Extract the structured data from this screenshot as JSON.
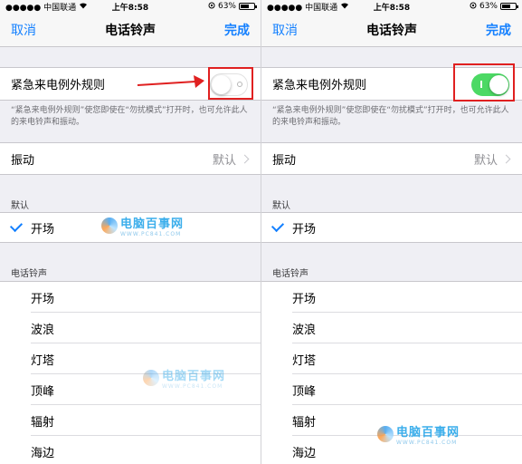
{
  "screens": [
    {
      "status": {
        "carrier": "●●●●● 中国联通",
        "wifi_icon": "wifi-icon",
        "time": "上午8:58",
        "battery": "63%",
        "battery_level": 0.63
      },
      "nav": {
        "cancel": "取消",
        "title": "电话铃声",
        "done": "完成"
      },
      "emergency": {
        "label": "紧急来电例外规则",
        "switch_on": false,
        "note": "“紧急来电例外规则”使您即使在“勿扰模式”打开时，也可允许此人的来电铃声和振动。"
      },
      "vibration": {
        "label": "振动",
        "value": "默认"
      },
      "default_header": "默认",
      "selected_tone": "开场",
      "ringtones_header": "电话铃声",
      "ringtones": [
        "开场",
        "波浪",
        "灯塔",
        "顶峰",
        "辐射",
        "海边"
      ]
    },
    {
      "status": {
        "carrier": "●●●●● 中国联通",
        "wifi_icon": "wifi-icon",
        "time": "上午8:58",
        "battery": "63%",
        "battery_level": 0.63
      },
      "nav": {
        "cancel": "取消",
        "title": "电话铃声",
        "done": "完成"
      },
      "emergency": {
        "label": "紧急来电例外规则",
        "switch_on": true,
        "note": "“紧急来电例外规则”使您即使在“勿扰模式”打开时，也可允许此人的来电铃声和振动。"
      },
      "vibration": {
        "label": "振动",
        "value": "默认"
      },
      "default_header": "默认",
      "selected_tone": "开场",
      "ringtones_header": "电话铃声",
      "ringtones": [
        "开场",
        "波浪",
        "灯塔",
        "顶峰",
        "辐射",
        "海边"
      ]
    }
  ],
  "watermark": {
    "name": "电脑百事网",
    "url": "WWW.PC841.COM"
  },
  "colors": {
    "accent": "#1480ff",
    "switch_on": "#4cd964",
    "highlight": "#e02020"
  }
}
